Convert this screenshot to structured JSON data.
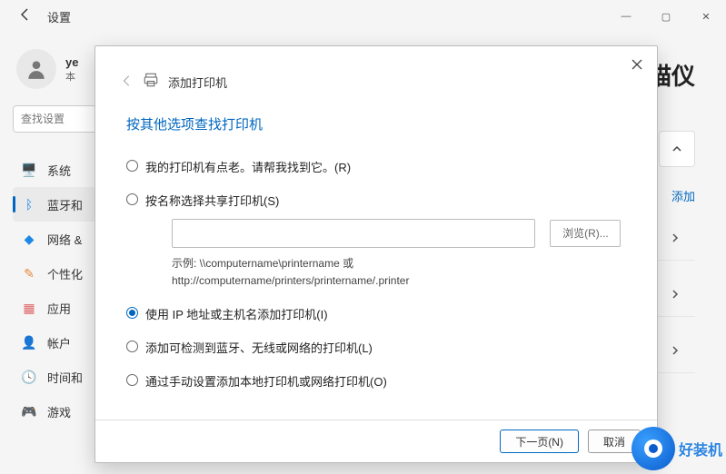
{
  "window": {
    "title": "设置",
    "min": "—",
    "max": "▢",
    "close": "✕"
  },
  "profile": {
    "name": "ye",
    "sub": "本"
  },
  "search": {
    "placeholder": "查找设置"
  },
  "nav": {
    "items": [
      {
        "icon": "🖥️",
        "label": "系统",
        "color": "#1e88e5"
      },
      {
        "icon": "ᛒ",
        "label": "蓝牙和",
        "color": "#1e88e5",
        "active": true
      },
      {
        "icon": "◆",
        "label": "网络 &",
        "color": "#1e88e5"
      },
      {
        "icon": "✎",
        "label": "个性化",
        "color": "#e68a3c"
      },
      {
        "icon": "▦",
        "label": "应用",
        "color": "#d66"
      },
      {
        "icon": "👤",
        "label": "帐户",
        "color": "#2e9e6f"
      },
      {
        "icon": "🕓",
        "label": "时间和",
        "color": "#3c76c9"
      },
      {
        "icon": "🎮",
        "label": "游戏",
        "color": "#777"
      }
    ]
  },
  "content": {
    "title_fragment": "描仪",
    "add_link": "添加"
  },
  "dialog": {
    "header": "添加打印机",
    "subtitle": "按其他选项查找打印机",
    "options": {
      "old": "我的打印机有点老。请帮我找到它。(R)",
      "share": "按名称选择共享打印机(S)",
      "share_example_l1": "示例: \\\\computername\\printername 或",
      "share_example_l2": "http://computername/printers/printername/.printer",
      "browse": "浏览(R)...",
      "ip": "使用 IP 地址或主机名添加打印机(I)",
      "bt": "添加可检测到蓝牙、无线或网络的打印机(L)",
      "manual": "通过手动设置添加本地打印机或网络打印机(O)"
    },
    "buttons": {
      "next": "下一页(N)",
      "cancel": "取消"
    }
  },
  "watermark": "好装机"
}
